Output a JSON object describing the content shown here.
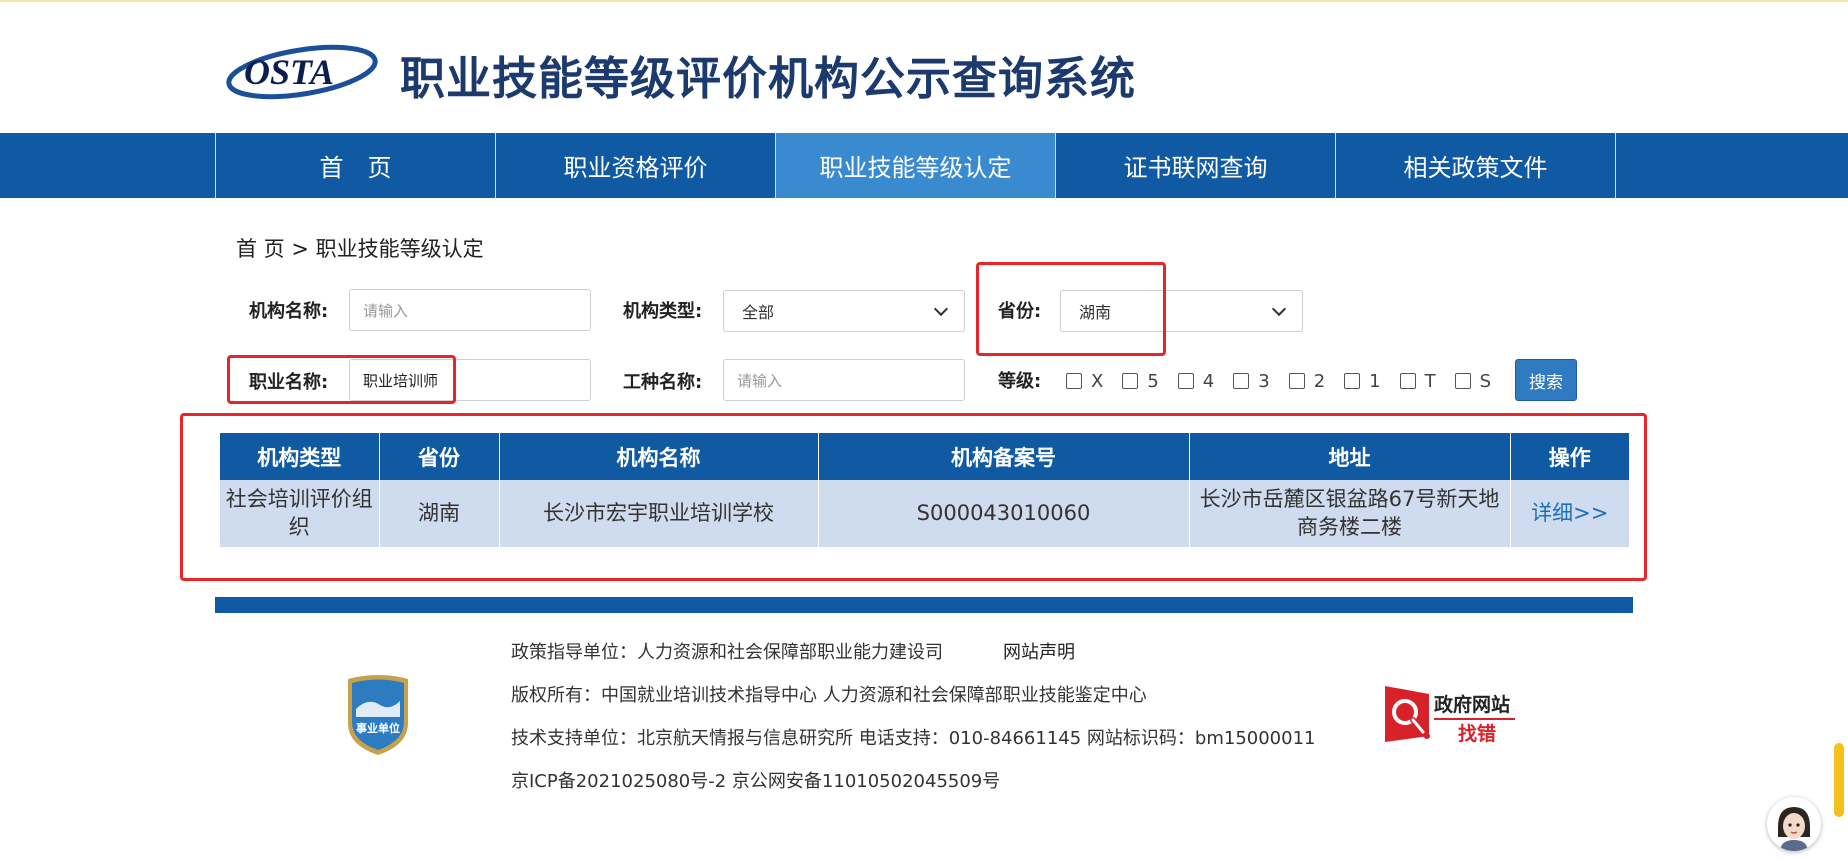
{
  "header": {
    "logo_text": "OSTA",
    "title": "职业技能等级评价机构公示查询系统"
  },
  "nav": {
    "items": [
      {
        "label": "首　页"
      },
      {
        "label": "职业资格评价"
      },
      {
        "label": "职业技能等级认定"
      },
      {
        "label": "证书联网查询"
      },
      {
        "label": "相关政策文件"
      }
    ],
    "active_index": 2
  },
  "breadcrumb": "首  页 > 职业技能等级认定",
  "filters": {
    "org_name_label": "机构名称:",
    "org_name_placeholder": "请输入",
    "org_type_label": "机构类型:",
    "org_type_value": "全部",
    "province_label": "省份:",
    "province_value": "湖南",
    "occupation_label": "职业名称:",
    "occupation_value": "职业培训师",
    "job_type_label": "工种名称:",
    "job_type_placeholder": "请输入",
    "grade_label": "等级:",
    "grades": [
      "X",
      "5",
      "4",
      "3",
      "2",
      "1",
      "T",
      "S"
    ],
    "search_label": "搜索"
  },
  "table": {
    "columns": [
      "机构类型",
      "省份",
      "机构名称",
      "机构备案号",
      "地址",
      "操作"
    ],
    "rows": [
      {
        "type": "社会培训评价组织",
        "province": "湖南",
        "name": "长沙市宏宇职业培训学校",
        "record_no": "S000043010060",
        "address": "长沙市岳麓区银盆路67号新天地商务楼二楼",
        "action": "详细>>"
      }
    ]
  },
  "footer": {
    "emblem_text": "事业单位",
    "line1": "政策指导单位：人力资源和社会保障部职业能力建设司",
    "statement": "网站声明",
    "line2": "版权所有：中国就业培训技术指导中心  人力资源和社会保障部职业技能鉴定中心",
    "line3": "技术支持单位：北京航天情报与信息研究所   电话支持：010-84661145   网站标识码：bm15000011",
    "line4": "京ICP备2021025080号-2    京公网安备11010502045509号",
    "gov_badge_line1": "政府网站",
    "gov_badge_line2": "找错"
  },
  "colors": {
    "nav_blue": "#0f5aa3",
    "nav_active": "#3a8ad0",
    "table_row": "#cfdcef",
    "highlight_red": "#e8262a",
    "link_blue": "#1f6fb8"
  }
}
